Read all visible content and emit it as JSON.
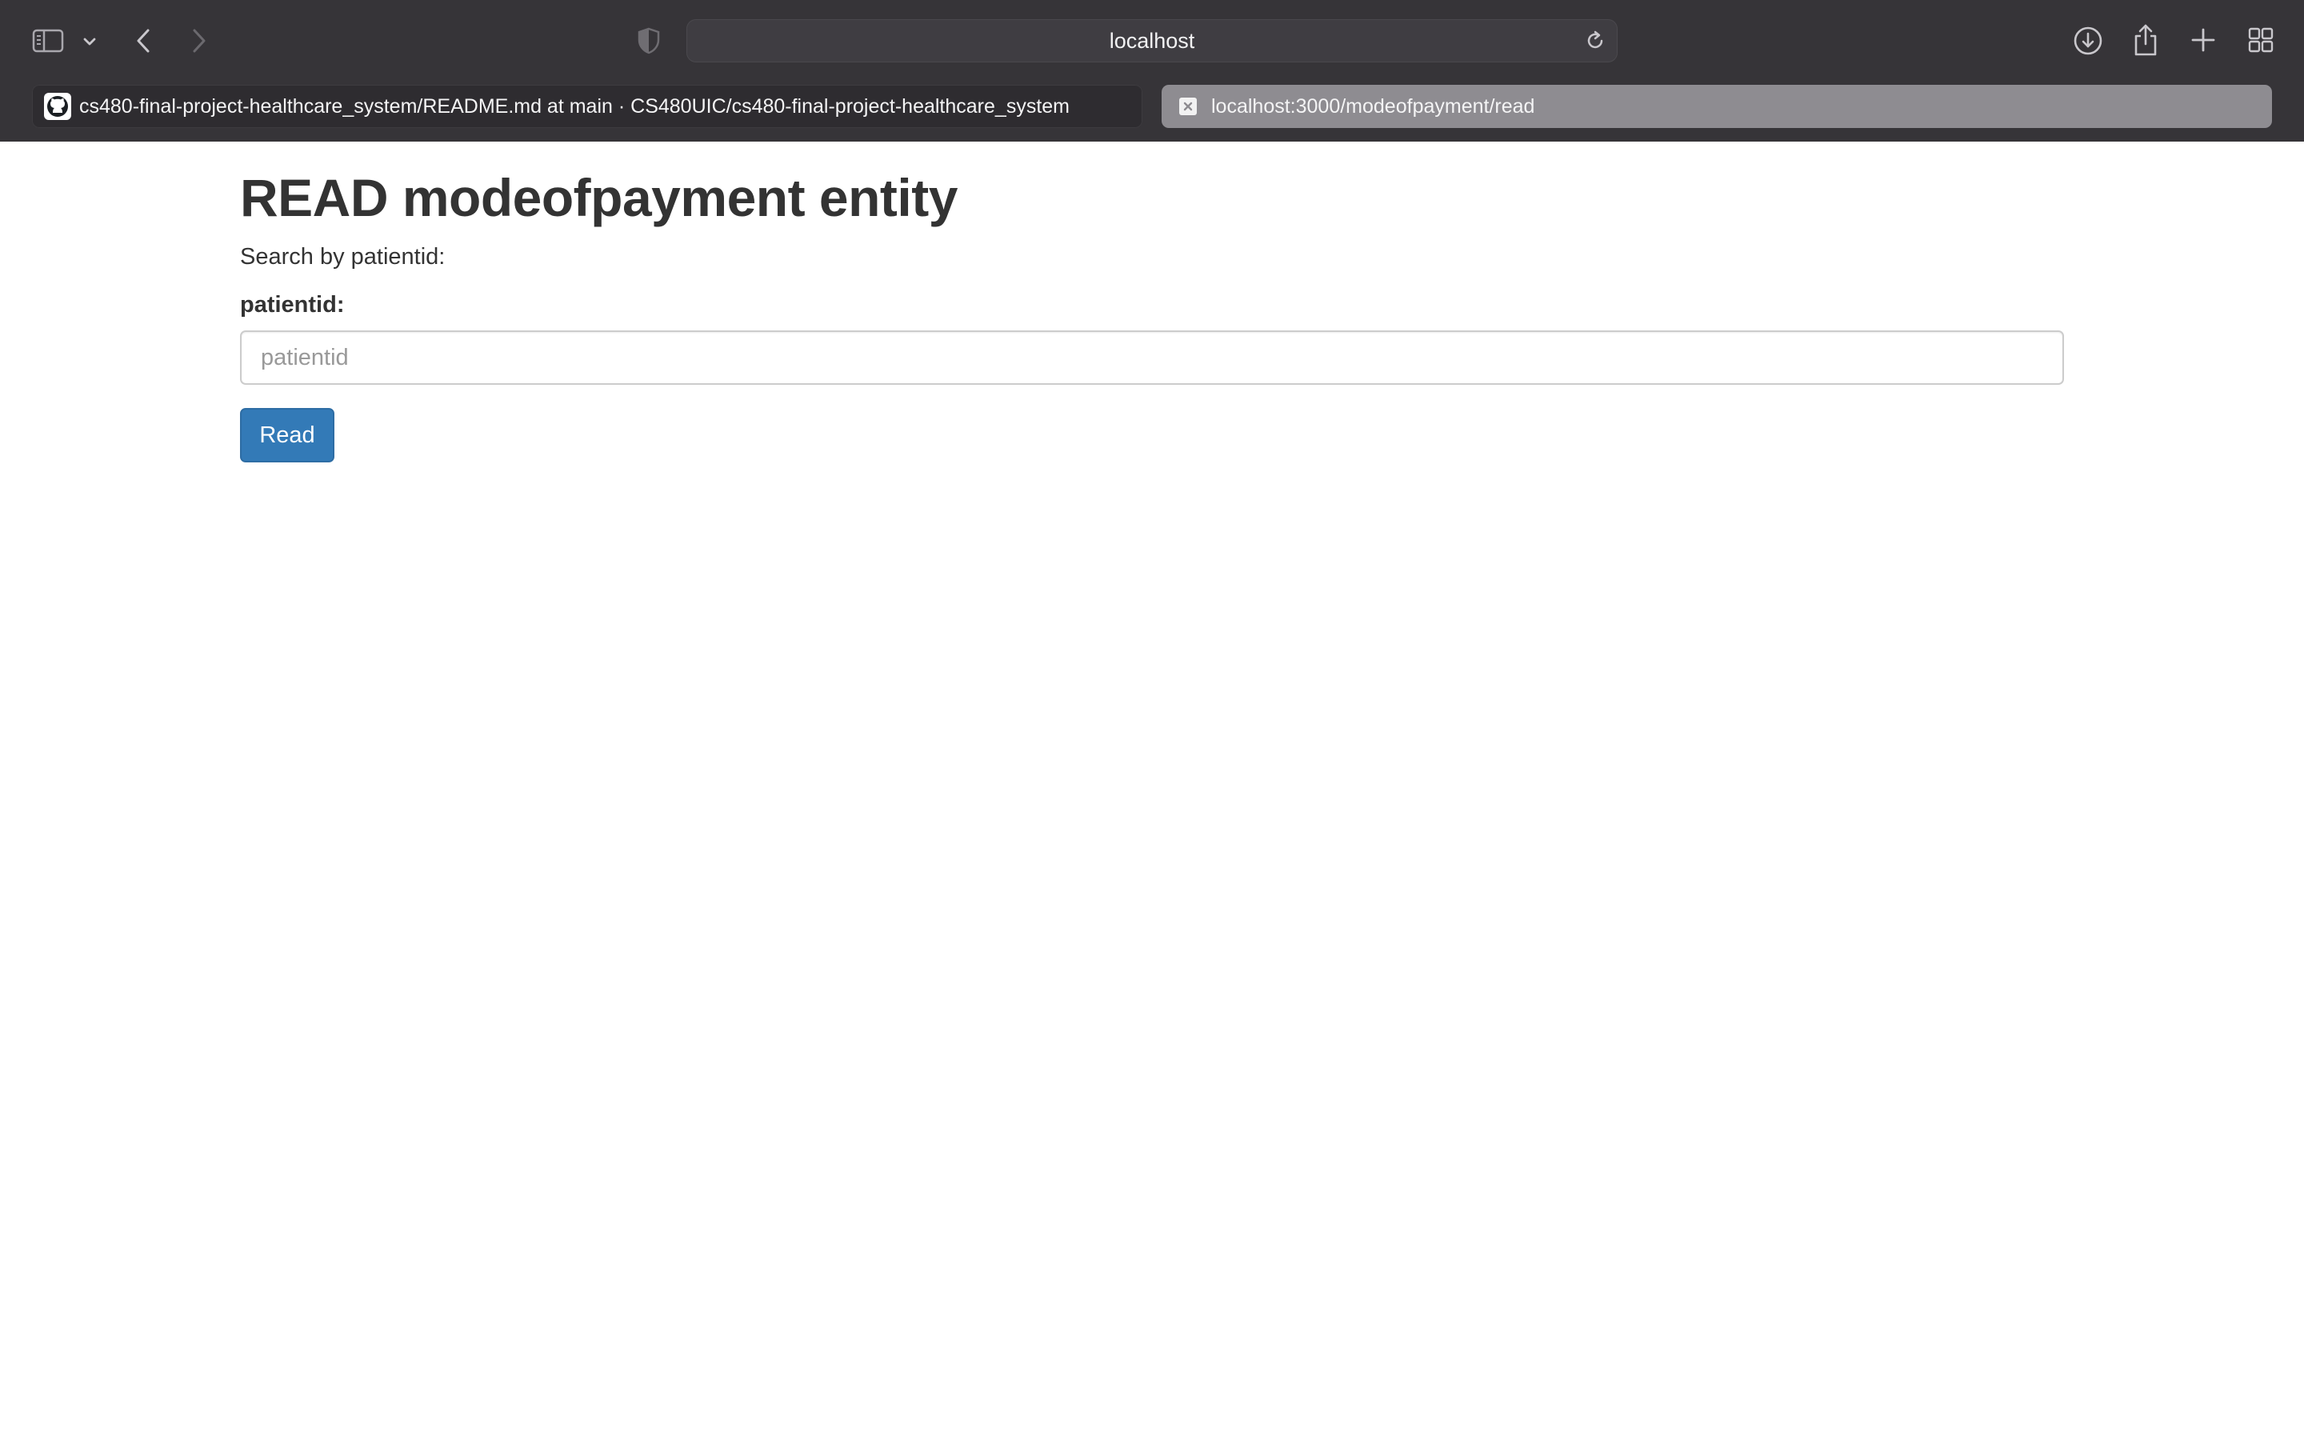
{
  "browser": {
    "address": "localhost",
    "tabs": [
      {
        "title": "cs480-final-project-healthcare_system/README.md at main · CS480UIC/cs480-final-project-healthcare_system",
        "favicon": "github-icon",
        "active": false
      },
      {
        "title": "localhost:3000/modeofpayment/read",
        "favicon": "default-page-icon",
        "active": true
      }
    ],
    "icons": [
      "sidebar-icon",
      "chevron-down-icon",
      "back-icon",
      "forward-icon",
      "privacy-shield-icon",
      "reload-icon",
      "download-icon",
      "share-icon",
      "new-tab-icon",
      "tab-overview-icon"
    ]
  },
  "page": {
    "title": "READ modeofpayment entity",
    "intro": "Search by patientid:",
    "field_label": "patientid:",
    "input": {
      "value": "",
      "placeholder": "patientid"
    },
    "submit_label": "Read"
  },
  "colors": {
    "chrome_bg": "#363438",
    "active_tab_bg": "#8e8c91",
    "primary_button": "#337ab7",
    "heading_text": "#333333"
  }
}
